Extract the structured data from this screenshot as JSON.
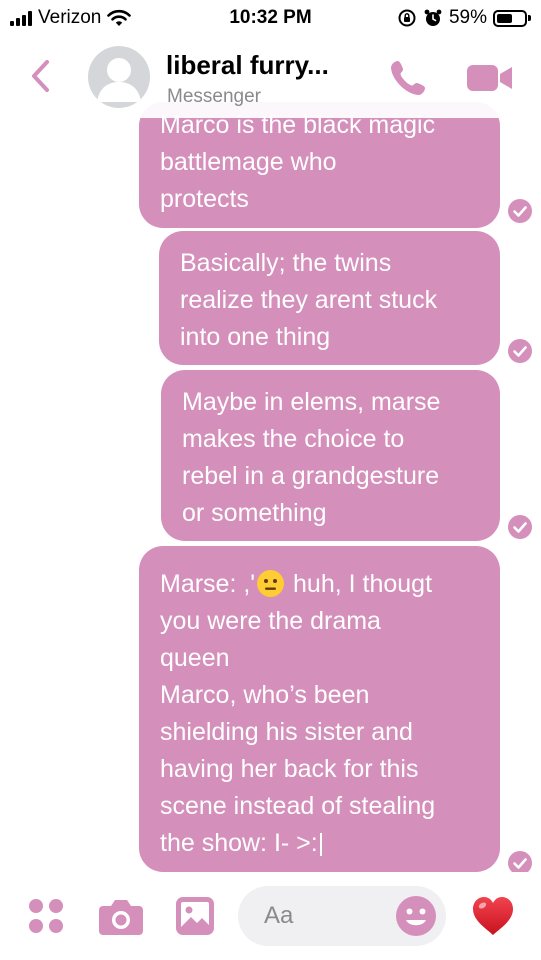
{
  "status_bar": {
    "carrier": "Verizon",
    "time": "10:32 PM",
    "battery_percent": "59%",
    "battery_level": 0.59,
    "icons": [
      "cellular-signal-icon",
      "wifi-icon",
      "orientation-lock-icon",
      "alarm-icon",
      "battery-icon"
    ]
  },
  "header": {
    "back_icon": "chevron-left-icon",
    "title": "liberal furry...",
    "subtitle": "Messenger",
    "call_icon": "phone-icon",
    "video_icon": "video-camera-icon"
  },
  "messages": [
    {
      "lines": [
        "Marco is the black magic",
        "battlemage who",
        "protects"
      ],
      "status_icon": "delivered-check-icon"
    },
    {
      "lines": [
        "Basically; the twins",
        "realize they arent stuck",
        "into one thing"
      ],
      "status_icon": "delivered-check-icon"
    },
    {
      "lines": [
        "Maybe in elems, marse",
        "makes the choice to",
        "rebel in a grandgesture",
        "or something"
      ],
      "status_icon": "delivered-check-icon"
    },
    {
      "lines": [
        "Marse: ,'",
        "huh, I thougt",
        "you were the drama",
        "queen",
        "Marco, who’s been",
        "shielding his sister and",
        "having her back for this",
        "scene instead of stealing",
        "the show: I- >:|"
      ],
      "emoji": "neutral-face-emoji",
      "status_icon": "delivered-check-icon"
    }
  ],
  "composer": {
    "menu_icon": "four-dots-menu-icon",
    "camera_icon": "camera-icon",
    "gallery_icon": "image-icon",
    "placeholder": "Aa",
    "emoji_icon": "smiley-icon",
    "like_icon": "heart-icon"
  },
  "colors": {
    "accent": "#d48fbb",
    "bubble": "#d48fbb",
    "bubble_text": "#ffffff",
    "heart": "#e0202e"
  }
}
